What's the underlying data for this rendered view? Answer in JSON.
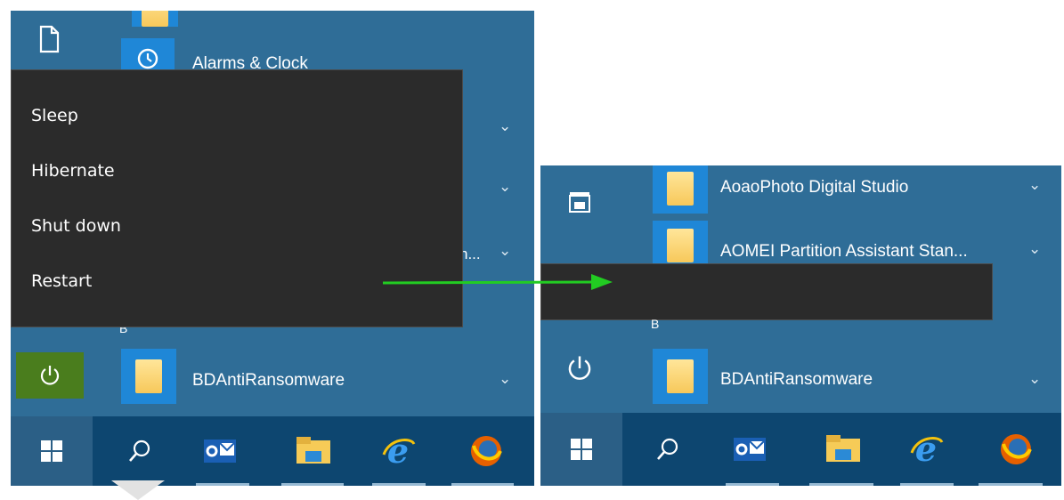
{
  "left": {
    "partial_app": "Alarms & Clock",
    "truncated_fragment": "n...",
    "letter_header": "B",
    "power_menu": [
      "Sleep",
      "Hibernate",
      "Shut down",
      "Restart"
    ],
    "app_bdanti": "BDAntiRansomware"
  },
  "right": {
    "apps": [
      "AoaoPhoto Digital Studio",
      "AOMEI Partition Assistant Stan..."
    ],
    "letter_header": "B",
    "app_bdanti": "BDAntiRansomware"
  },
  "colors": {
    "start_bg": "#2f6d97",
    "tile": "#1f87d7",
    "menu_bg": "#2b2b2b",
    "power_active": "#4a7d1d",
    "arrow": "#22cc22",
    "taskbar": "#0d4670"
  },
  "icons": [
    "document-icon",
    "power-icon",
    "windows-start-icon",
    "search-icon",
    "outlook-icon",
    "file-explorer-icon",
    "internet-explorer-icon",
    "firefox-icon",
    "folder-icon",
    "chevron-down-icon",
    "alarm-clock-icon"
  ]
}
